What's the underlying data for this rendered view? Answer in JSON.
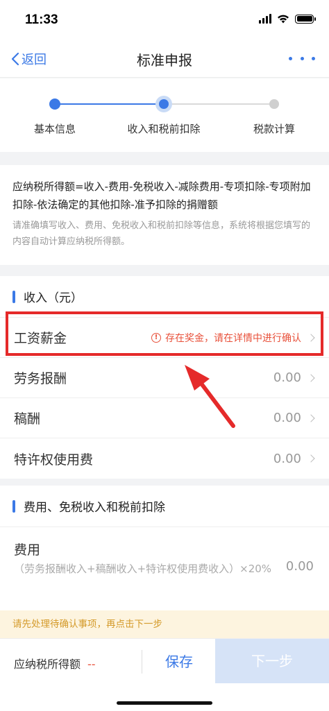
{
  "status": {
    "time": "11:33"
  },
  "nav": {
    "back_label": "返回",
    "title": "标准申报"
  },
  "steps": [
    {
      "label": "基本信息",
      "state": "done"
    },
    {
      "label": "收入和税前扣除",
      "state": "current"
    },
    {
      "label": "税款计算",
      "state": "pending"
    }
  ],
  "formula": {
    "text": "应纳税所得额=收入-费用-免税收入-减除费用-专项扣除-专项附加扣除-依法确定的其他扣除-准予扣除的捐赠额",
    "hint": "请准确填写收入、费用、免税收入和税前扣除等信息，系统将根据您填写的内容自动计算应纳税所得额。"
  },
  "income": {
    "title": "收入（元）",
    "rows": [
      {
        "label": "工资薪金",
        "warning": "存在奖金，请在详情中进行确认",
        "warning_icon": "!"
      },
      {
        "label": "劳务报酬",
        "value": "0.00"
      },
      {
        "label": "稿酬",
        "value": "0.00"
      },
      {
        "label": "特许权使用费",
        "value": "0.00"
      }
    ]
  },
  "deductions": {
    "title": "费用、免税收入和税前扣除",
    "fee": {
      "label": "费用",
      "formula": "（劳务报酬收入+稿酬收入+特许权使用费收入）×20%",
      "value": "0.00"
    }
  },
  "notice": "请先处理待确认事项，再点击下一步",
  "bottom": {
    "tax_label": "应纳税所得额",
    "tax_value": "--",
    "save_label": "保存",
    "next_label": "下一步"
  },
  "colors": {
    "accent": "#3b79e6",
    "warning": "#e8503a",
    "highlight": "#e52a2a",
    "notice_bg": "#fdf4df"
  }
}
